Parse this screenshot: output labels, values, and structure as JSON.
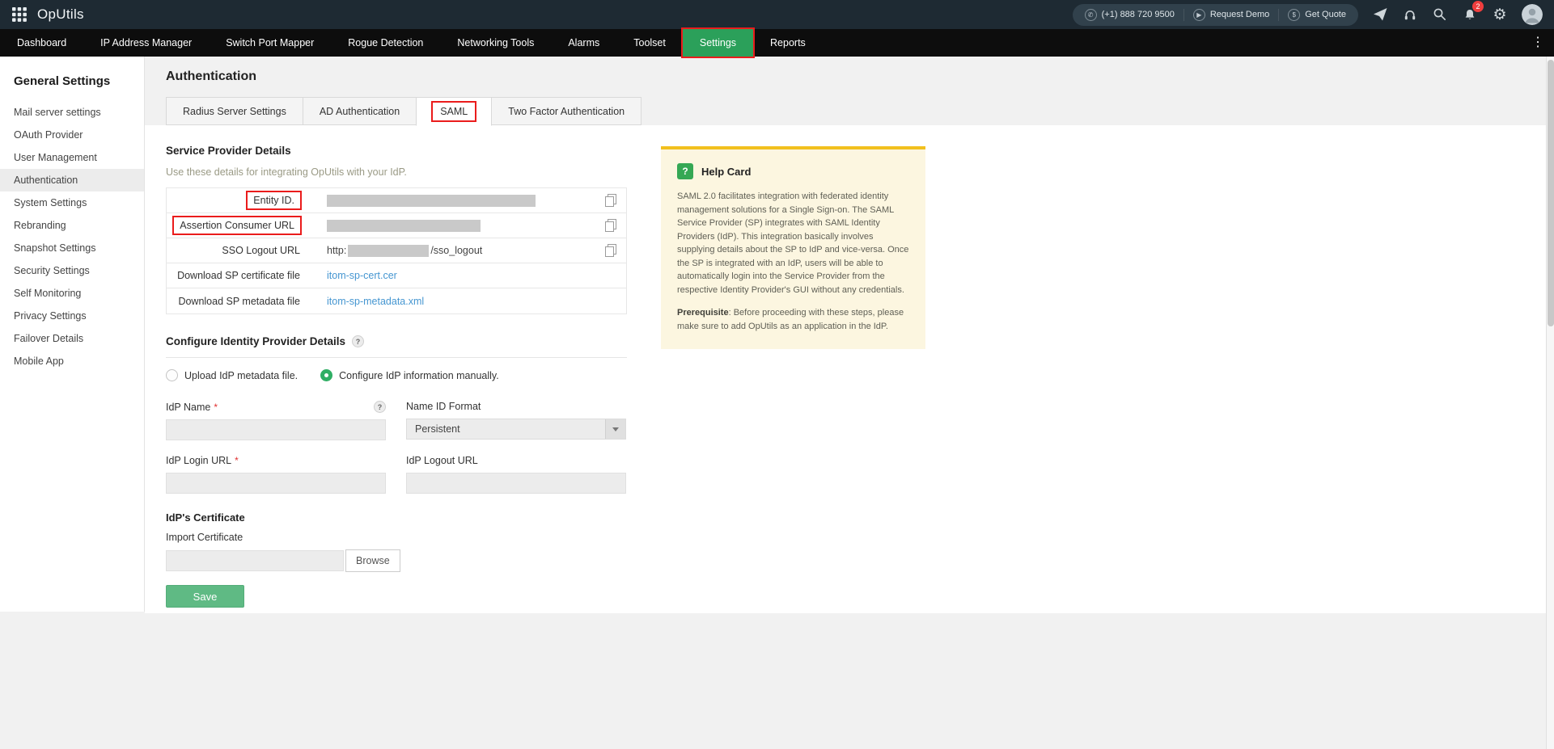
{
  "topbar": {
    "logo": "OpUtils",
    "phone": "(+1) 888 720 9500",
    "request_demo": "Request Demo",
    "get_quote": "Get Quote",
    "notification_count": "2"
  },
  "icons": {
    "gear": "⚙",
    "overflow_menu": "⋮",
    "phone": "✆",
    "demo": "▶",
    "quote": "$",
    "help": "?"
  },
  "nav": {
    "items": [
      "Dashboard",
      "IP Address Manager",
      "Switch Port Mapper",
      "Rogue Detection",
      "Networking Tools",
      "Alarms",
      "Toolset",
      "Settings",
      "Reports"
    ],
    "active": "Settings"
  },
  "sidebar": {
    "title": "General Settings",
    "items": [
      "Mail server settings",
      "OAuth Provider",
      "User Management",
      "Authentication",
      "System Settings",
      "Rebranding",
      "Snapshot Settings",
      "Security Settings",
      "Self Monitoring",
      "Privacy Settings",
      "Failover Details",
      "Mobile App"
    ],
    "active": "Authentication"
  },
  "page": {
    "title": "Authentication"
  },
  "tabs": {
    "items": [
      "Radius Server Settings",
      "AD Authentication",
      "SAML",
      "Two Factor Authentication"
    ],
    "active": "SAML"
  },
  "sp": {
    "title": "Service Provider Details",
    "subtitle": "Use these details for integrating OpUtils with your IdP.",
    "entity_label": "Entity ID.",
    "acs_label": "Assertion Consumer URL",
    "sso_label": "SSO Logout URL",
    "sso_prefix": "http:",
    "sso_suffix": "/sso_logout",
    "cert_label": "Download SP certificate file",
    "cert_link": "itom-sp-cert.cer",
    "meta_label": "Download SP metadata file",
    "meta_link": "itom-sp-metadata.xml"
  },
  "idp": {
    "title": "Configure Identity Provider Details",
    "radio_upload": "Upload IdP metadata file.",
    "radio_manual": "Configure IdP information manually.",
    "name_label": "IdP Name",
    "required_marker": "*",
    "name_format_label": "Name ID Format",
    "name_format_value": "Persistent",
    "login_label": "IdP Login URL",
    "logout_label": "IdP Logout URL",
    "cert_title": "IdP's Certificate",
    "import_label": "Import Certificate",
    "browse_label": "Browse",
    "save_label": "Save"
  },
  "help": {
    "title": "Help Card",
    "body": "SAML 2.0 facilitates integration with federated identity management solutions for a Single Sign-on. The SAML Service Provider (SP) integrates with SAML Identity Providers (IdP). This integration basically involves supplying details about the SP to IdP and vice-versa. Once the SP is integrated with an IdP, users will be able to automatically login into the Service Provider from the respective Identity Provider's GUI without any credentials.",
    "prereq_label": "Prerequisite",
    "prereq_text": ": Before proceeding with these steps, please make sure to add OpUtils as an application in the IdP."
  },
  "colors": {
    "topbar_bg": "#1e2a33",
    "nav_bg": "#0d0d0d",
    "accent_green": "#2BA05A",
    "annotation_red": "#ea1c1c",
    "link_blue": "#4596d1",
    "help_bg": "#fcf6e0",
    "help_border": "#f2c01d",
    "save_green": "#5fba84"
  }
}
